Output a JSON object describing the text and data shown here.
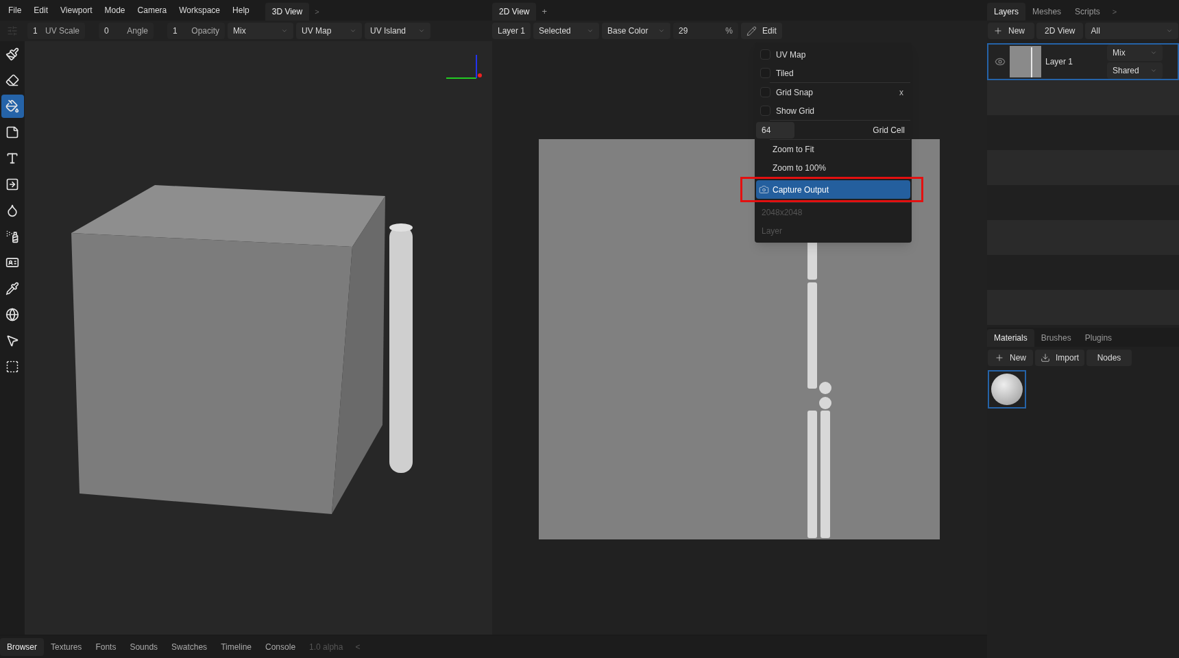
{
  "menu_bar": [
    "File",
    "Edit",
    "Viewport",
    "Mode",
    "Camera",
    "Workspace",
    "Help"
  ],
  "left_tabs": [
    {
      "label": "3D View",
      "selected": true
    }
  ],
  "left_tabs_more": ">",
  "right_tabs": [
    {
      "label": "2D View",
      "selected": true
    }
  ],
  "right_tabs_add": "+",
  "brush_toolbar": {
    "fields": [
      {
        "value": "1",
        "label": "UV Scale"
      },
      {
        "value": "0",
        "label": "Angle"
      },
      {
        "value": "1",
        "label": "Opacity"
      }
    ],
    "dropdowns": [
      "Mix",
      "UV Map",
      "UV Island"
    ]
  },
  "view2d_toolbar": {
    "layer": "Layer 1",
    "dropdowns": [
      "Selected",
      "Base Color"
    ],
    "zoom": {
      "value": "29",
      "unit": "%"
    },
    "edit": "Edit"
  },
  "tools": [
    {
      "kind": "brush",
      "selected": false
    },
    {
      "kind": "eraser",
      "selected": false
    },
    {
      "kind": "fill",
      "selected": true
    },
    {
      "kind": "decal",
      "selected": false
    },
    {
      "kind": "text",
      "selected": false
    },
    {
      "kind": "clone",
      "selected": false
    },
    {
      "kind": "blur",
      "selected": false
    },
    {
      "kind": "smudge",
      "selected": false
    },
    {
      "kind": "id",
      "selected": false
    },
    {
      "kind": "picker",
      "selected": false
    },
    {
      "kind": "material",
      "selected": false
    },
    {
      "kind": "pointer",
      "selected": false
    },
    {
      "kind": "select",
      "selected": false
    }
  ],
  "edit_menu": {
    "sections": [
      [
        {
          "kind": "checkbox",
          "label": "UV Map",
          "checked": false
        },
        {
          "kind": "checkbox",
          "label": "Tiled",
          "checked": false
        }
      ],
      [
        {
          "kind": "checkbox",
          "label": "Grid Snap",
          "checked": false,
          "shortcut": "x"
        },
        {
          "kind": "checkbox",
          "label": "Show Grid",
          "checked": false
        }
      ],
      [
        {
          "kind": "field",
          "value": "64",
          "label": "Grid Cell"
        }
      ],
      [
        {
          "kind": "action",
          "label": "Zoom to Fit",
          "selected": false,
          "highlight": false
        },
        {
          "kind": "action",
          "label": "Zoom to 100%",
          "selected": false,
          "highlight": false
        },
        {
          "kind": "capture",
          "label": "Capture Output",
          "selected": true,
          "highlight": true
        }
      ],
      [
        {
          "kind": "info",
          "label": "2048x2048"
        },
        {
          "kind": "info",
          "label": "Layer"
        }
      ]
    ]
  },
  "layers_panel": {
    "tabs": [
      {
        "label": "Layers",
        "selected": true
      },
      {
        "label": "Meshes",
        "selected": false
      },
      {
        "label": "Scripts",
        "selected": false
      }
    ],
    "more": ">",
    "new_button": "New",
    "view_button": "2D View",
    "filter": "All",
    "layers": [
      {
        "name": "Layer 1",
        "visible": true,
        "blend": "Mix",
        "mode": "Shared",
        "selected": true
      }
    ]
  },
  "materials_panel": {
    "tabs": [
      {
        "label": "Materials",
        "selected": true
      },
      {
        "label": "Brushes",
        "selected": false
      },
      {
        "label": "Plugins",
        "selected": false
      }
    ],
    "buttons": [
      {
        "kind": "new",
        "label": "New"
      },
      {
        "kind": "import",
        "label": "Import"
      },
      {
        "kind": "plain",
        "label": "Nodes"
      }
    ],
    "materials": [
      {
        "selected": true
      }
    ]
  },
  "bottom_bar": {
    "tabs": [
      {
        "label": "Browser",
        "selected": true
      },
      {
        "label": "Textures",
        "selected": false
      },
      {
        "label": "Fonts",
        "selected": false
      },
      {
        "label": "Sounds",
        "selected": false
      },
      {
        "label": "Swatches",
        "selected": false
      },
      {
        "label": "Timeline",
        "selected": false
      },
      {
        "label": "Console",
        "selected": false
      }
    ],
    "version": "1.0 alpha",
    "collapse": "<"
  }
}
